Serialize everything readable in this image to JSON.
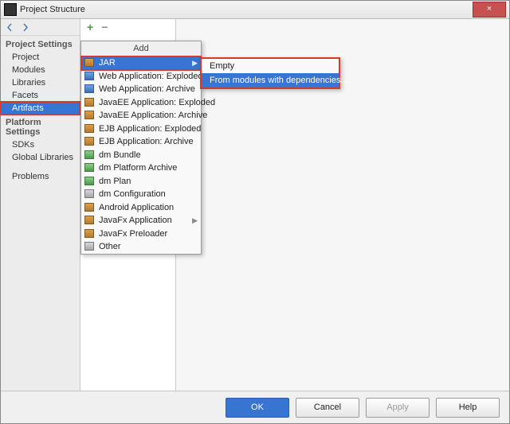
{
  "window": {
    "title": "Project Structure",
    "close_glyph": "×"
  },
  "sidebar": {
    "groups": [
      {
        "heading": "Project Settings",
        "items": [
          {
            "label": "Project",
            "selected": false
          },
          {
            "label": "Modules",
            "selected": false
          },
          {
            "label": "Libraries",
            "selected": false
          },
          {
            "label": "Facets",
            "selected": false
          },
          {
            "label": "Artifacts",
            "selected": true,
            "highlight": true
          }
        ]
      },
      {
        "heading": "Platform Settings",
        "items": [
          {
            "label": "SDKs",
            "selected": false
          },
          {
            "label": "Global Libraries",
            "selected": false
          }
        ]
      },
      {
        "heading": "",
        "items": [
          {
            "label": "Problems",
            "selected": false
          }
        ]
      }
    ]
  },
  "mid_toolbar": {
    "plus_glyph": "+",
    "minus_glyph": "−"
  },
  "add_menu": {
    "title": "Add",
    "items": [
      {
        "label": "JAR",
        "icon": "ic",
        "selected": true,
        "submenu": true,
        "highlight": true
      },
      {
        "label": "Web Application: Exploded",
        "icon": "ic blue",
        "selected": false
      },
      {
        "label": "Web Application: Archive",
        "icon": "ic blue",
        "selected": false
      },
      {
        "label": "JavaEE Application: Exploded",
        "icon": "ic",
        "selected": false
      },
      {
        "label": "JavaEE Application: Archive",
        "icon": "ic",
        "selected": false
      },
      {
        "label": "EJB Application: Exploded",
        "icon": "ic",
        "selected": false
      },
      {
        "label": "EJB Application: Archive",
        "icon": "ic",
        "selected": false
      },
      {
        "label": "dm Bundle",
        "icon": "ic green",
        "selected": false
      },
      {
        "label": "dm Platform Archive",
        "icon": "ic green",
        "selected": false
      },
      {
        "label": "dm Plan",
        "icon": "ic green",
        "selected": false
      },
      {
        "label": "dm Configuration",
        "icon": "ic grey",
        "selected": false
      },
      {
        "label": "Android Application",
        "icon": "ic",
        "selected": false
      },
      {
        "label": "JavaFx Application",
        "icon": "ic",
        "selected": false,
        "submenu": true
      },
      {
        "label": "JavaFx Preloader",
        "icon": "ic",
        "selected": false
      },
      {
        "label": "Other",
        "icon": "ic grey",
        "selected": false
      }
    ]
  },
  "jar_submenu": {
    "items": [
      {
        "label": "Empty",
        "selected": false
      },
      {
        "label": "From modules with dependencies...",
        "selected": true,
        "highlight": true
      }
    ]
  },
  "footer": {
    "ok": "OK",
    "cancel": "Cancel",
    "apply": "Apply",
    "help": "Help"
  }
}
